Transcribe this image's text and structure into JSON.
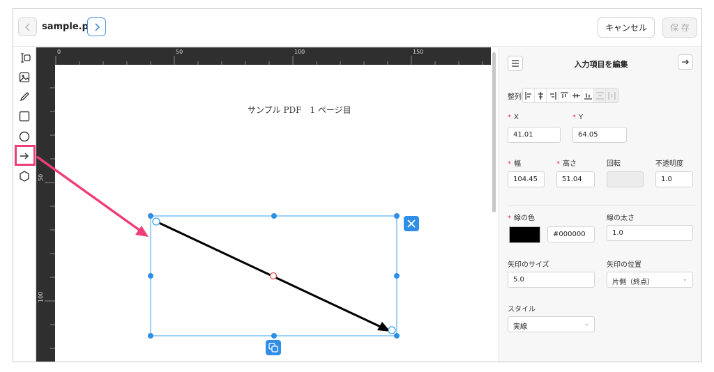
{
  "header": {
    "back_icon": "chevron-left-icon",
    "forward_icon": "chevron-right-icon",
    "filename": "sample.pdf",
    "cancel_label": "キャンセル",
    "save_label": "保 存"
  },
  "toolbar": {
    "items": [
      {
        "name": "text-field-tool",
        "icon": "text-cursor-icon"
      },
      {
        "name": "image-tool",
        "icon": "image-icon"
      },
      {
        "name": "pen-tool",
        "icon": "pencil-icon"
      },
      {
        "name": "rectangle-tool",
        "icon": "square-icon"
      },
      {
        "name": "ellipse-tool",
        "icon": "circle-icon"
      },
      {
        "name": "arrow-tool",
        "icon": "arrow-right-icon",
        "active": true
      },
      {
        "name": "polygon-tool",
        "icon": "hexagon-icon"
      }
    ]
  },
  "ruler": {
    "top_labels": [
      "0",
      "50",
      "100",
      "150"
    ],
    "left_labels": [
      "50",
      "100"
    ]
  },
  "page": {
    "text": "サンプル PDF　1 ページ目"
  },
  "colors": {
    "accent": "#2f8fe8",
    "selection": "#1e90ff",
    "highlight": "#ee3d77",
    "arrow": "#000000"
  },
  "panel": {
    "menu_icon": "hamburger-icon",
    "title": "入力項目を編集",
    "collapse_icon": "arrow-right-icon",
    "align_label": "整列:",
    "align_buttons": [
      "align-left-icon",
      "align-center-h-icon",
      "align-right-icon",
      "align-top-icon",
      "align-middle-v-icon",
      "align-bottom-icon",
      "distribute-h-icon",
      "distribute-v-icon"
    ],
    "x_label": "X",
    "x_value": "41.01",
    "y_label": "Y",
    "y_value": "64.05",
    "width_label": "幅",
    "width_value": "104.45",
    "height_label": "高さ",
    "height_value": "51.04",
    "rotation_label": "回転",
    "rotation_value": "",
    "opacity_label": "不透明度",
    "opacity_value": "1.0",
    "line_color_label": "線の色",
    "line_color_value": "#000000",
    "line_width_label": "線の太さ",
    "line_width_value": "1.0",
    "arrow_size_label": "矢印のサイズ",
    "arrow_size_value": "5.0",
    "arrow_position_label": "矢印の位置",
    "arrow_position_value": "片側（終点）",
    "style_label": "スタイル",
    "style_value": "実線"
  }
}
